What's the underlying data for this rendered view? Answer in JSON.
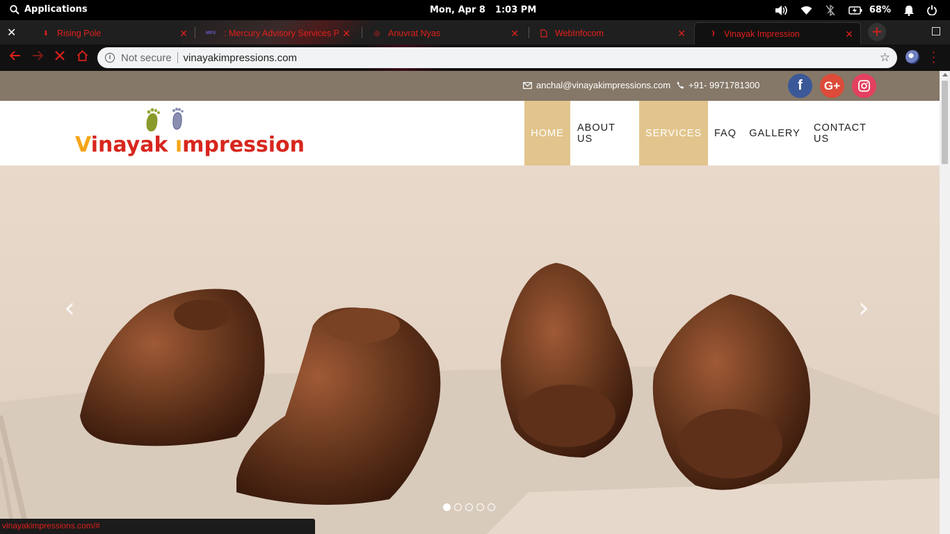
{
  "system_bar": {
    "applications_label": "Applications",
    "date": "Mon, Apr  8",
    "time": "1:03 PM",
    "battery_percent": "68%",
    "icons": [
      "search-icon",
      "volume-icon",
      "wifi-icon",
      "bluetooth-off-icon",
      "battery-icon",
      "notification-bell-icon",
      "power-icon"
    ]
  },
  "browser": {
    "tabs": [
      {
        "title": "Rising Pole",
        "icon": "site-favicon"
      },
      {
        "title": ": Mercury Advisory Services P",
        "icon": "mafs-favicon"
      },
      {
        "title": "Anuvrat Nyas",
        "icon": "spinner-favicon"
      },
      {
        "title": "WebInfocom",
        "icon": "page-icon"
      },
      {
        "title": "Vinayak Impression",
        "icon": "loading-icon",
        "active": true
      }
    ],
    "omnibox": {
      "security_label": "Not secure",
      "url": "vinayakimpressions.com"
    },
    "status_url": "vinayakimpressions.com/#",
    "accent_color": "#e0201b"
  },
  "site": {
    "contact": {
      "email": "anchal@vinayakimpressions.com",
      "phone": "+91- 9971781300"
    },
    "social": [
      {
        "name": "facebook",
        "glyph": "f",
        "color": "#3b5998"
      },
      {
        "name": "google-plus",
        "glyph": "G+",
        "color": "#dd4b39"
      },
      {
        "name": "instagram",
        "glyph": "◎",
        "color": "#e4405f"
      }
    ],
    "logo": {
      "first_letter": "V",
      "text_part1": "inayak ",
      "text_part2": "mpression"
    },
    "nav": [
      {
        "label": "HOME",
        "highlight": true
      },
      {
        "label": "ABOUT US",
        "highlight": false
      },
      {
        "label": "SERVICES",
        "highlight": true
      },
      {
        "label": "FAQ",
        "highlight": false
      },
      {
        "label": "GALLERY",
        "highlight": false
      },
      {
        "label": "CONTACT US",
        "highlight": false
      }
    ],
    "slider": {
      "prev_glyph": "‹",
      "next_glyph": "›",
      "slide_count": 5,
      "active_index": 0,
      "image_subject": "bronze baby hand and foot casts"
    },
    "colors": {
      "contact_bar": "#857868",
      "nav_highlight": "#e2c58d",
      "bronze": "#6b3a1f"
    }
  }
}
